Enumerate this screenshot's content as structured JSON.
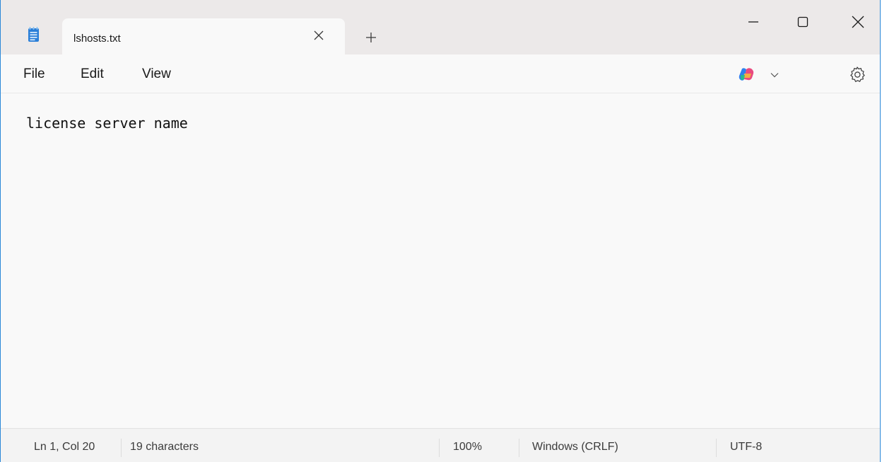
{
  "tab": {
    "title": "lshosts.txt"
  },
  "menu": {
    "items": [
      "File",
      "Edit",
      "View"
    ]
  },
  "editor": {
    "content": "license server name"
  },
  "status": {
    "position": "Ln 1, Col 20",
    "characters": "19 characters",
    "zoom": "100%",
    "line_ending": "Windows (CRLF)",
    "encoding": "UTF-8"
  },
  "icons": {
    "app": "notepad-icon",
    "tab_close": "close-icon",
    "new_tab": "plus-icon",
    "minimize": "minimize-icon",
    "maximize": "maximize-icon",
    "close": "close-icon",
    "copilot": "copilot-icon",
    "settings": "gear-icon"
  }
}
